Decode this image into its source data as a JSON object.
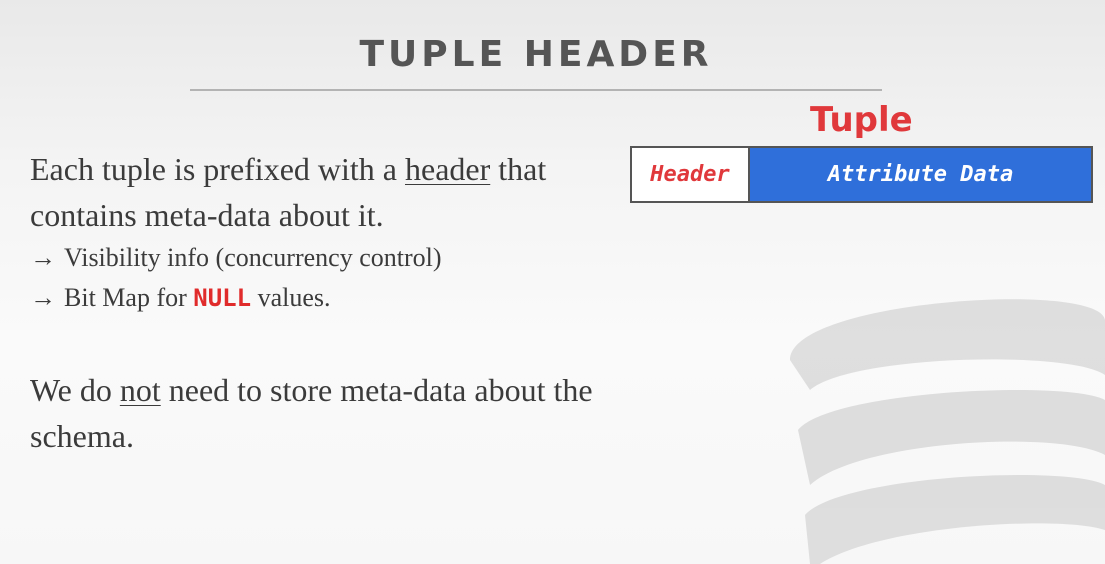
{
  "slide": {
    "title": "TUPLE HEADER",
    "paragraph1": {
      "before": "Each tuple is prefixed with a ",
      "underlined": "header",
      "after": " that contains meta-data about it."
    },
    "bullets": [
      {
        "arrow": "→",
        "text": "Visibility info (concurrency control)"
      },
      {
        "arrow": "→",
        "before": "Bit Map for ",
        "keyword": "NULL",
        "after": " values."
      }
    ],
    "paragraph2": {
      "before": "We do ",
      "underlined": "not",
      "after": " need to store meta-data about the schema."
    }
  },
  "diagram": {
    "label": "Tuple",
    "cells": {
      "header": "Header",
      "attribute": "Attribute Data"
    }
  },
  "colors": {
    "title": "#555555",
    "accent_red": "#e0383b",
    "attribute_blue": "#2f6fda",
    "body_text": "#3b3b3b"
  },
  "icons": {
    "watermark": "database-cylinder-icon"
  }
}
